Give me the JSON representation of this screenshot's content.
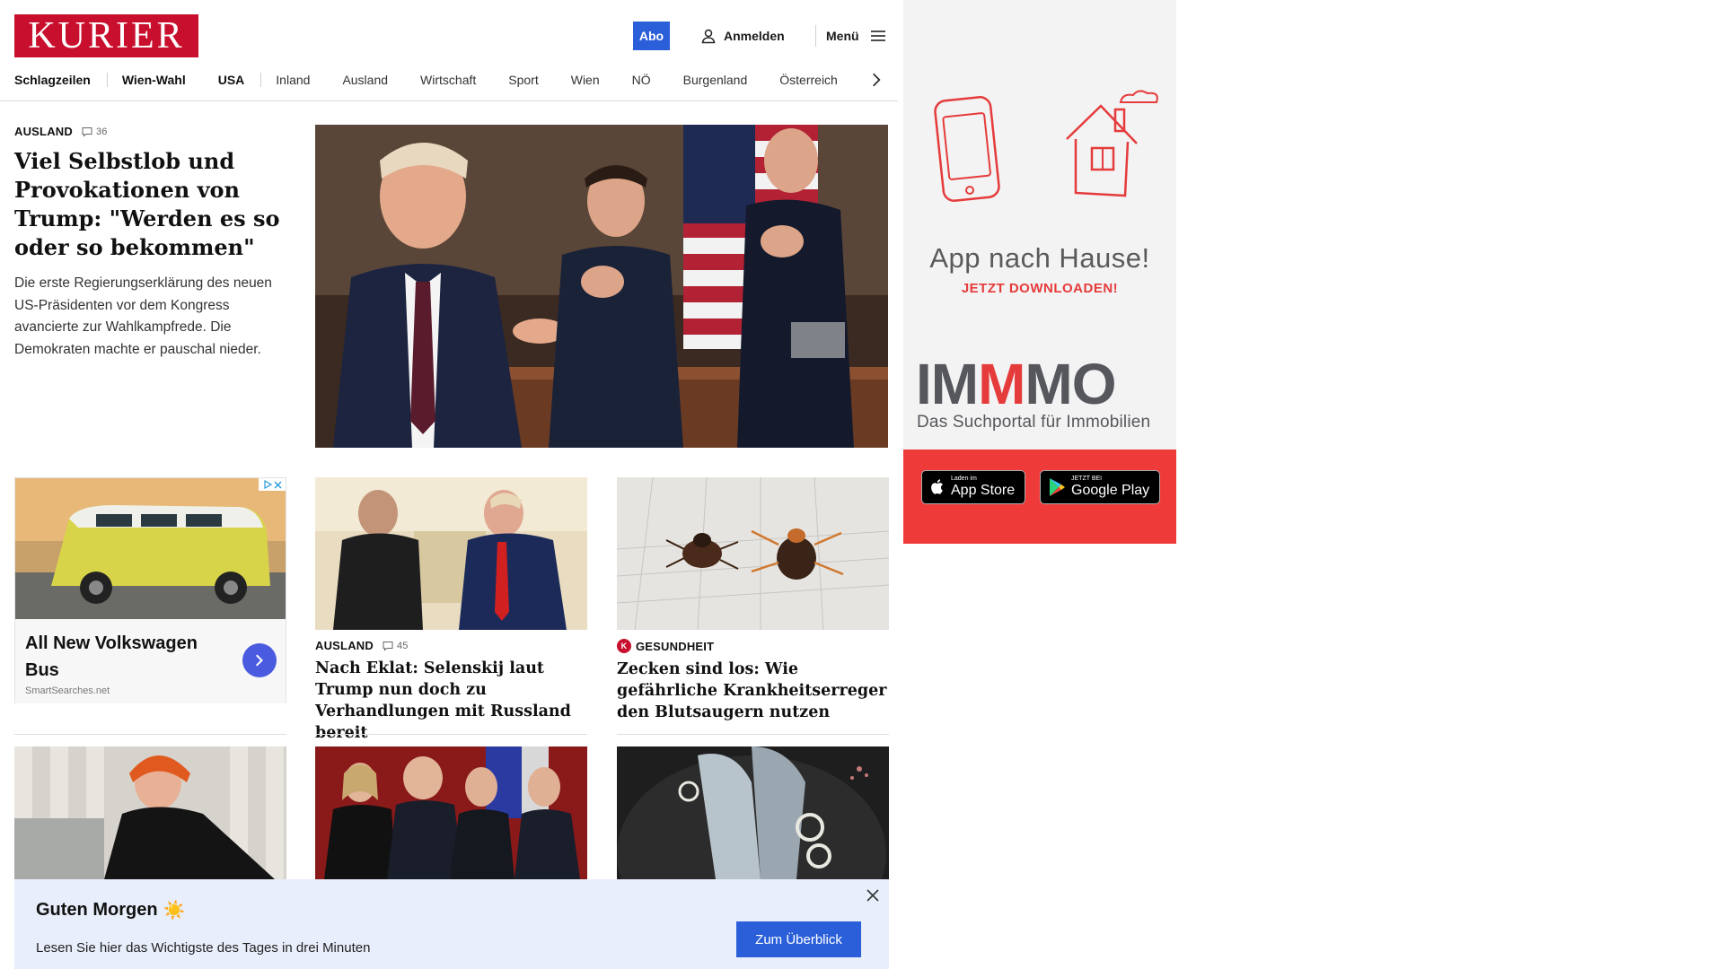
{
  "header": {
    "logo": "KURIER",
    "abo": "Abo",
    "login": "Anmelden",
    "menu": "Menü"
  },
  "nav": [
    "Schlagzeilen",
    "Wien-Wahl",
    "USA",
    "Inland",
    "Ausland",
    "Wirtschaft",
    "Sport",
    "Wien",
    "NÖ",
    "Burgenland",
    "Österreich"
  ],
  "lead": {
    "kicker": "AUSLAND",
    "comments": "36",
    "title": "Viel Selbstlob und Provokationen von Trump: \"Werden es so oder so bekommen\"",
    "teaser": "Die erste Regierungserklärung des neuen US-Präsidenten vor dem Kongress avancierte zur Wahlkampfrede. Die Demokraten machte er pauschal nieder."
  },
  "ad": {
    "title": "All New Volkswagen Bus",
    "source": "SmartSearches.net"
  },
  "cards": [
    {
      "kicker": "AUSLAND",
      "comments": "45",
      "title": "Nach Eklat: Selenskij laut Trump nun doch zu Verhandlungen mit Russland bereit"
    },
    {
      "kicker": "GESUNDHEIT",
      "badge": "K",
      "title": "Zecken sind los: Wie gefährliche Krankheitserreger den Blutsaugern nutzen"
    }
  ],
  "notification": {
    "title": "Guten Morgen",
    "emoji": "☀️",
    "subtitle": "Lesen Sie hier das Wichtigste des Tages in drei Minuten",
    "button": "Zum Überblick"
  },
  "promo": {
    "headline": "App nach Hause!",
    "cta": "JETZT DOWNLOADEN!",
    "brand_a": "IM",
    "brand_b": "M",
    "brand_c": "MO",
    "brand_sub": "Das Suchportal für Immobilien",
    "appstore_small": "Laden im",
    "appstore_big": "App Store",
    "googleplay_small": "JETZT BEI",
    "googleplay_big": "Google Play"
  },
  "colors": {
    "brand_red": "#c8102e",
    "link_blue": "#2b5fd9",
    "promo_red": "#ef3a3a"
  }
}
